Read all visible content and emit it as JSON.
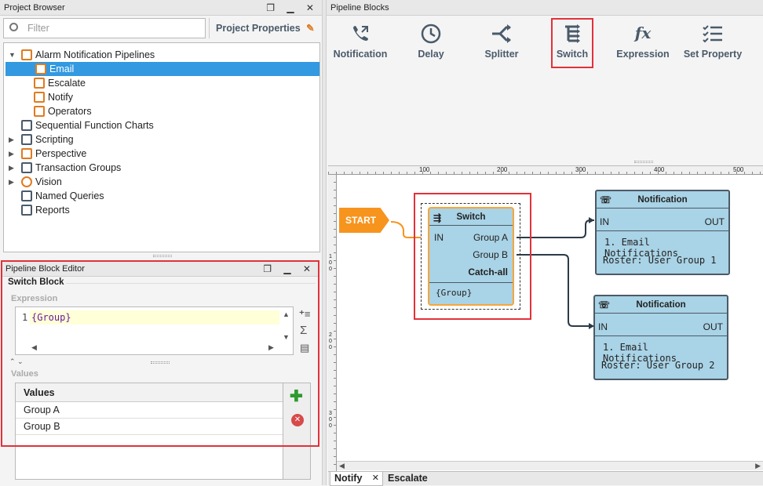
{
  "project_browser": {
    "title": "Project Browser",
    "filter_placeholder": "Filter",
    "project_properties": "Project Properties",
    "tree": [
      {
        "label": "Alarm Notification Pipelines",
        "icon": "pipeline-icon"
      },
      {
        "label": "Email",
        "icon": "pipeline-icon",
        "selected": true
      },
      {
        "label": "Escalate",
        "icon": "pipeline-icon"
      },
      {
        "label": "Notify",
        "icon": "pipeline-icon"
      },
      {
        "label": "Operators",
        "icon": "pipeline-icon"
      },
      {
        "label": "Sequential Function Charts",
        "icon": "sfc-icon"
      },
      {
        "label": "Scripting",
        "icon": "scripting-icon"
      },
      {
        "label": "Perspective",
        "icon": "perspective-icon"
      },
      {
        "label": "Transaction Groups",
        "icon": "transaction-icon"
      },
      {
        "label": "Vision",
        "icon": "vision-icon"
      },
      {
        "label": "Named Queries",
        "icon": "query-icon"
      },
      {
        "label": "Reports",
        "icon": "report-icon"
      }
    ]
  },
  "block_editor": {
    "title": "Pipeline Block Editor",
    "section": "Switch Block",
    "expression_label": "Expression",
    "line_number": "1",
    "expression": "{Group}",
    "values_label": "Values",
    "values_header": "Values",
    "values": [
      "Group A",
      "Group B"
    ]
  },
  "pipeline_blocks": {
    "title": "Pipeline Blocks",
    "items": [
      {
        "label": "Notification",
        "icon": "phone-icon"
      },
      {
        "label": "Delay",
        "icon": "clock-icon"
      },
      {
        "label": "Splitter",
        "icon": "split-icon"
      },
      {
        "label": "Switch",
        "icon": "switch-icon"
      },
      {
        "label": "Expression",
        "icon": "fx-icon"
      },
      {
        "label": "Set Property",
        "icon": "checklist-icon"
      }
    ]
  },
  "ruler": {
    "top": [
      "100",
      "200",
      "300",
      "400",
      "500"
    ],
    "left": [
      "100",
      "200",
      "300"
    ]
  },
  "canvas": {
    "start": "START",
    "switch": {
      "title": "Switch",
      "in": "IN",
      "outputs": [
        "Group A",
        "Group B",
        "Catch-all"
      ],
      "expression": "{Group}"
    },
    "notif1": {
      "title": "Notification",
      "in": "IN",
      "out": "OUT",
      "line1": "1. Email Notifications",
      "line2": "Roster: User Group 1"
    },
    "notif2": {
      "title": "Notification",
      "in": "IN",
      "out": "OUT",
      "line1": "1. Email Notifications",
      "line2": "Roster: User Group 2"
    }
  },
  "tabs": [
    {
      "label": "Notify",
      "active": true,
      "close": "✕"
    },
    {
      "label": "Escalate"
    }
  ],
  "colors": {
    "accent_red": "#e2313a",
    "selection": "#3399e0",
    "node_fill": "#a9d3e6",
    "start_orange": "#f7941d"
  }
}
